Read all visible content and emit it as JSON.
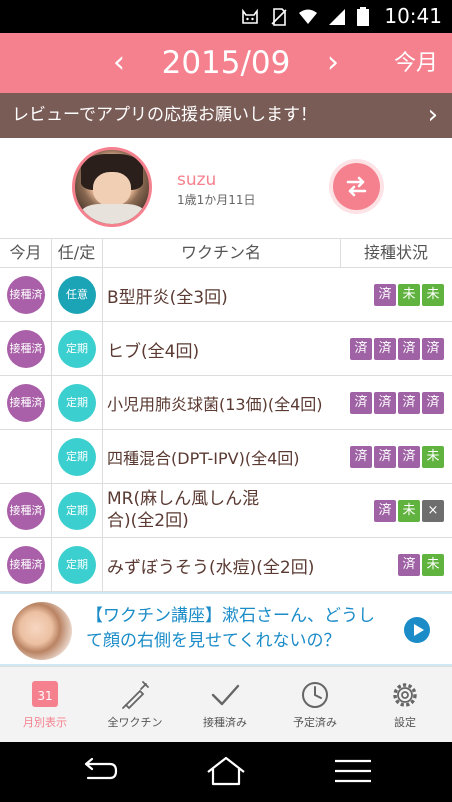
{
  "status_bar": {
    "time": "10:41",
    "battery": "87"
  },
  "header": {
    "prev": "‹",
    "month": "2015/09",
    "next": "›",
    "today": "今月"
  },
  "review": {
    "text": "レビューでアプリの応援お願いします！",
    "chevron": "›"
  },
  "profile": {
    "name": "suzu",
    "age": "1歳1か月11日"
  },
  "table": {
    "headers": [
      "今月",
      "任/定",
      "ワクチン名",
      "接種状況"
    ],
    "rows": [
      {
        "this_month": "接種済",
        "type": "任意",
        "name": "B型肝炎(全3回)",
        "status": [
          "済",
          "未",
          "未"
        ]
      },
      {
        "this_month": "接種済",
        "type": "定期",
        "name": "ヒブ(全4回)",
        "status": [
          "済",
          "済",
          "済",
          "済"
        ]
      },
      {
        "this_month": "接種済",
        "type": "定期",
        "name": "小児用肺炎球菌(13価)(全4回)",
        "status": [
          "済",
          "済",
          "済",
          "済"
        ]
      },
      {
        "this_month": "",
        "type": "定期",
        "name": "四種混合(DPT-IPV)(全4回)",
        "status": [
          "済",
          "済",
          "済",
          "未"
        ]
      },
      {
        "this_month": "接種済",
        "type": "定期",
        "name": "MR(麻しん風しん混合)(全2回)",
        "status": [
          "済",
          "未",
          "×"
        ]
      },
      {
        "this_month": "接種済",
        "type": "定期",
        "name": "みずぼうそう(水痘)(全2回)",
        "status": [
          "済",
          "未"
        ]
      }
    ]
  },
  "ad": {
    "text": "【ワクチン講座】漱石さーん、どうして顔の右側を見せてくれないの？"
  },
  "tabs": [
    {
      "label": "月別表示",
      "icon": "calendar-icon",
      "badge": "31",
      "active": true
    },
    {
      "label": "全ワクチン",
      "icon": "syringe-icon",
      "active": false
    },
    {
      "label": "接種済み",
      "icon": "checkmark-icon",
      "active": false
    },
    {
      "label": "予定済み",
      "icon": "clock-icon",
      "active": false
    },
    {
      "label": "設定",
      "icon": "gear-icon",
      "active": false
    }
  ],
  "colors": {
    "accent": "#f5818e",
    "banner": "#7a5c57",
    "done": "#a960a8",
    "optional": "#1ba3b6",
    "regular": "#3ccfcf",
    "not_yet": "#5fb33e"
  }
}
